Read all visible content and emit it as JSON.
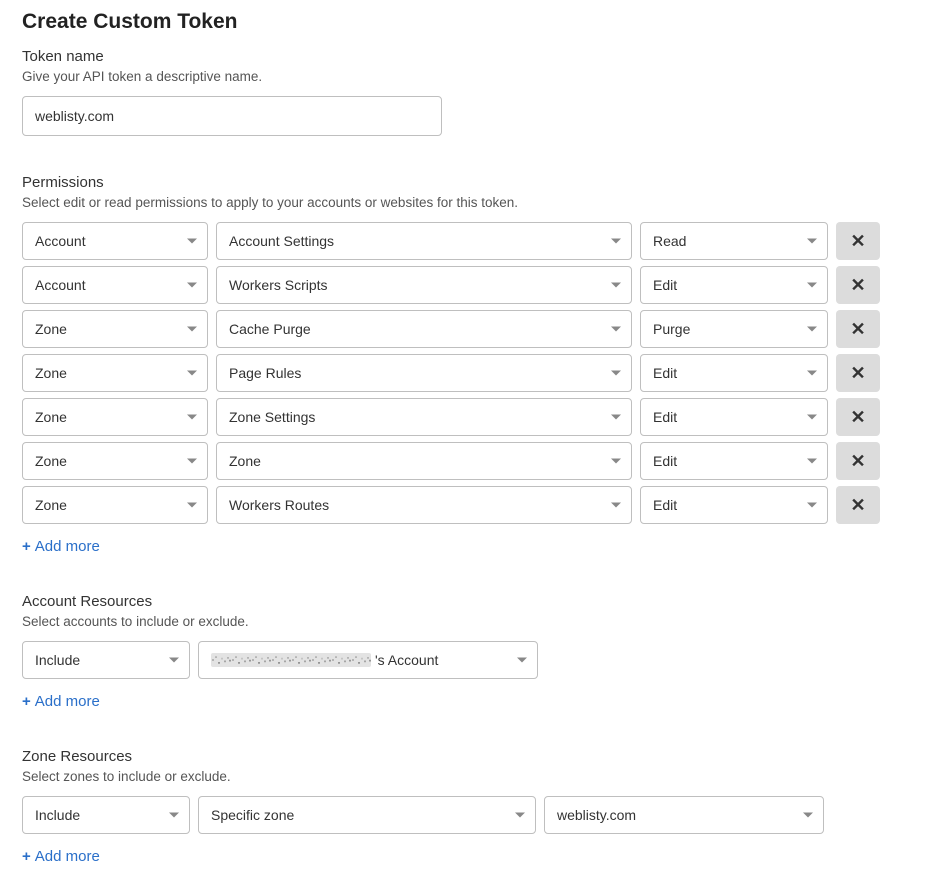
{
  "title": "Create Custom Token",
  "token_name": {
    "label": "Token name",
    "helper": "Give your API token a descriptive name.",
    "value": "weblisty.com"
  },
  "permissions": {
    "label": "Permissions",
    "helper": "Select edit or read permissions to apply to your accounts or websites for this token.",
    "add_more": "Add more",
    "remove_glyph": "✕",
    "rows": [
      {
        "scope": "Account",
        "item": "Account Settings",
        "action": "Read"
      },
      {
        "scope": "Account",
        "item": "Workers Scripts",
        "action": "Edit"
      },
      {
        "scope": "Zone",
        "item": "Cache Purge",
        "action": "Purge"
      },
      {
        "scope": "Zone",
        "item": "Page Rules",
        "action": "Edit"
      },
      {
        "scope": "Zone",
        "item": "Zone Settings",
        "action": "Edit"
      },
      {
        "scope": "Zone",
        "item": "Zone",
        "action": "Edit"
      },
      {
        "scope": "Zone",
        "item": "Workers Routes",
        "action": "Edit"
      }
    ]
  },
  "account_resources": {
    "label": "Account Resources",
    "helper": "Select accounts to include or exclude.",
    "add_more": "Add more",
    "row": {
      "mode": "Include",
      "account_suffix": "'s Account"
    }
  },
  "zone_resources": {
    "label": "Zone Resources",
    "helper": "Select zones to include or exclude.",
    "add_more": "Add more",
    "row": {
      "mode": "Include",
      "selector": "Specific zone",
      "zone": "weblisty.com"
    }
  }
}
